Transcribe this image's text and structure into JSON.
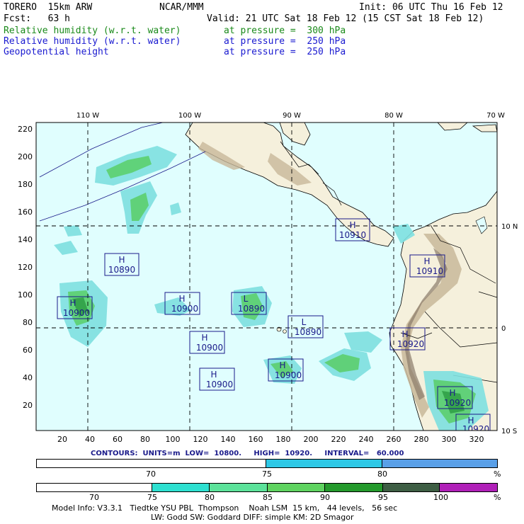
{
  "header": {
    "model": "TORERO  15km ARW",
    "org": "NCAR/MMM",
    "init": "Init: 06 UTC Thu 16 Feb 12",
    "fcst": "Fcst:   63 h",
    "valid": "Valid: 21 UTC Sat 18 Feb 12 (15 CST Sat 18 Feb 12)",
    "fields": [
      {
        "name": "Relative humidity (w.r.t. water)",
        "level": "at pressure =  300 hPa",
        "color": "#1a8a1a"
      },
      {
        "name": "Relative humidity (w.r.t. water)",
        "level": "at pressure =  250 hPa",
        "color": "#1a1ad0"
      },
      {
        "name": "Geopotential height",
        "level": "at pressure =  250 hPa",
        "color": "#1a1ad0"
      }
    ]
  },
  "map": {
    "lon_labels": [
      "110 W",
      "100 W",
      "90 W",
      "80 W",
      "70 W"
    ],
    "lat_labels": [
      "10 N",
      "0",
      "10 S"
    ],
    "y_ticks": [
      "220",
      "200",
      "180",
      "160",
      "140",
      "120",
      "100",
      "80",
      "60",
      "40",
      "20"
    ],
    "x_ticks": [
      "20",
      "40",
      "60",
      "80",
      "100",
      "120",
      "140",
      "160",
      "180",
      "200",
      "220",
      "240",
      "260",
      "280",
      "300",
      "320"
    ],
    "centers": [
      {
        "type": "H",
        "value": "10910"
      },
      {
        "type": "H",
        "value": "10890"
      },
      {
        "type": "H",
        "value": "10910"
      },
      {
        "type": "H",
        "value": "10900"
      },
      {
        "type": "H",
        "value": "10900"
      },
      {
        "type": "L",
        "value": "10890"
      },
      {
        "type": "L",
        "value": "10890"
      },
      {
        "type": "H",
        "value": "10900"
      },
      {
        "type": "H",
        "value": "10920"
      },
      {
        "type": "H",
        "value": "10900"
      },
      {
        "type": "H",
        "value": "10900"
      },
      {
        "type": "H",
        "value": "10920"
      },
      {
        "type": "H",
        "value": "10920"
      }
    ]
  },
  "contour_info": "CONTOURS:  UNITS=m  LOW=  10800.     HIGH=  10920.     INTERVAL=   60.000",
  "colorbar1": {
    "labels": [
      "70",
      "75",
      "80",
      "%"
    ]
  },
  "colorbar2": {
    "labels": [
      "70",
      "75",
      "80",
      "85",
      "90",
      "95",
      "100",
      "%"
    ]
  },
  "footer": {
    "line1": "Model Info: V3.3.1   Tiedtke YSU PBL  Thompson    Noah LSM  15 km,   44 levels,   56 sec",
    "line2": "LW: Godd SW: Goddard DIFF: simple KM: 2D Smagor"
  }
}
